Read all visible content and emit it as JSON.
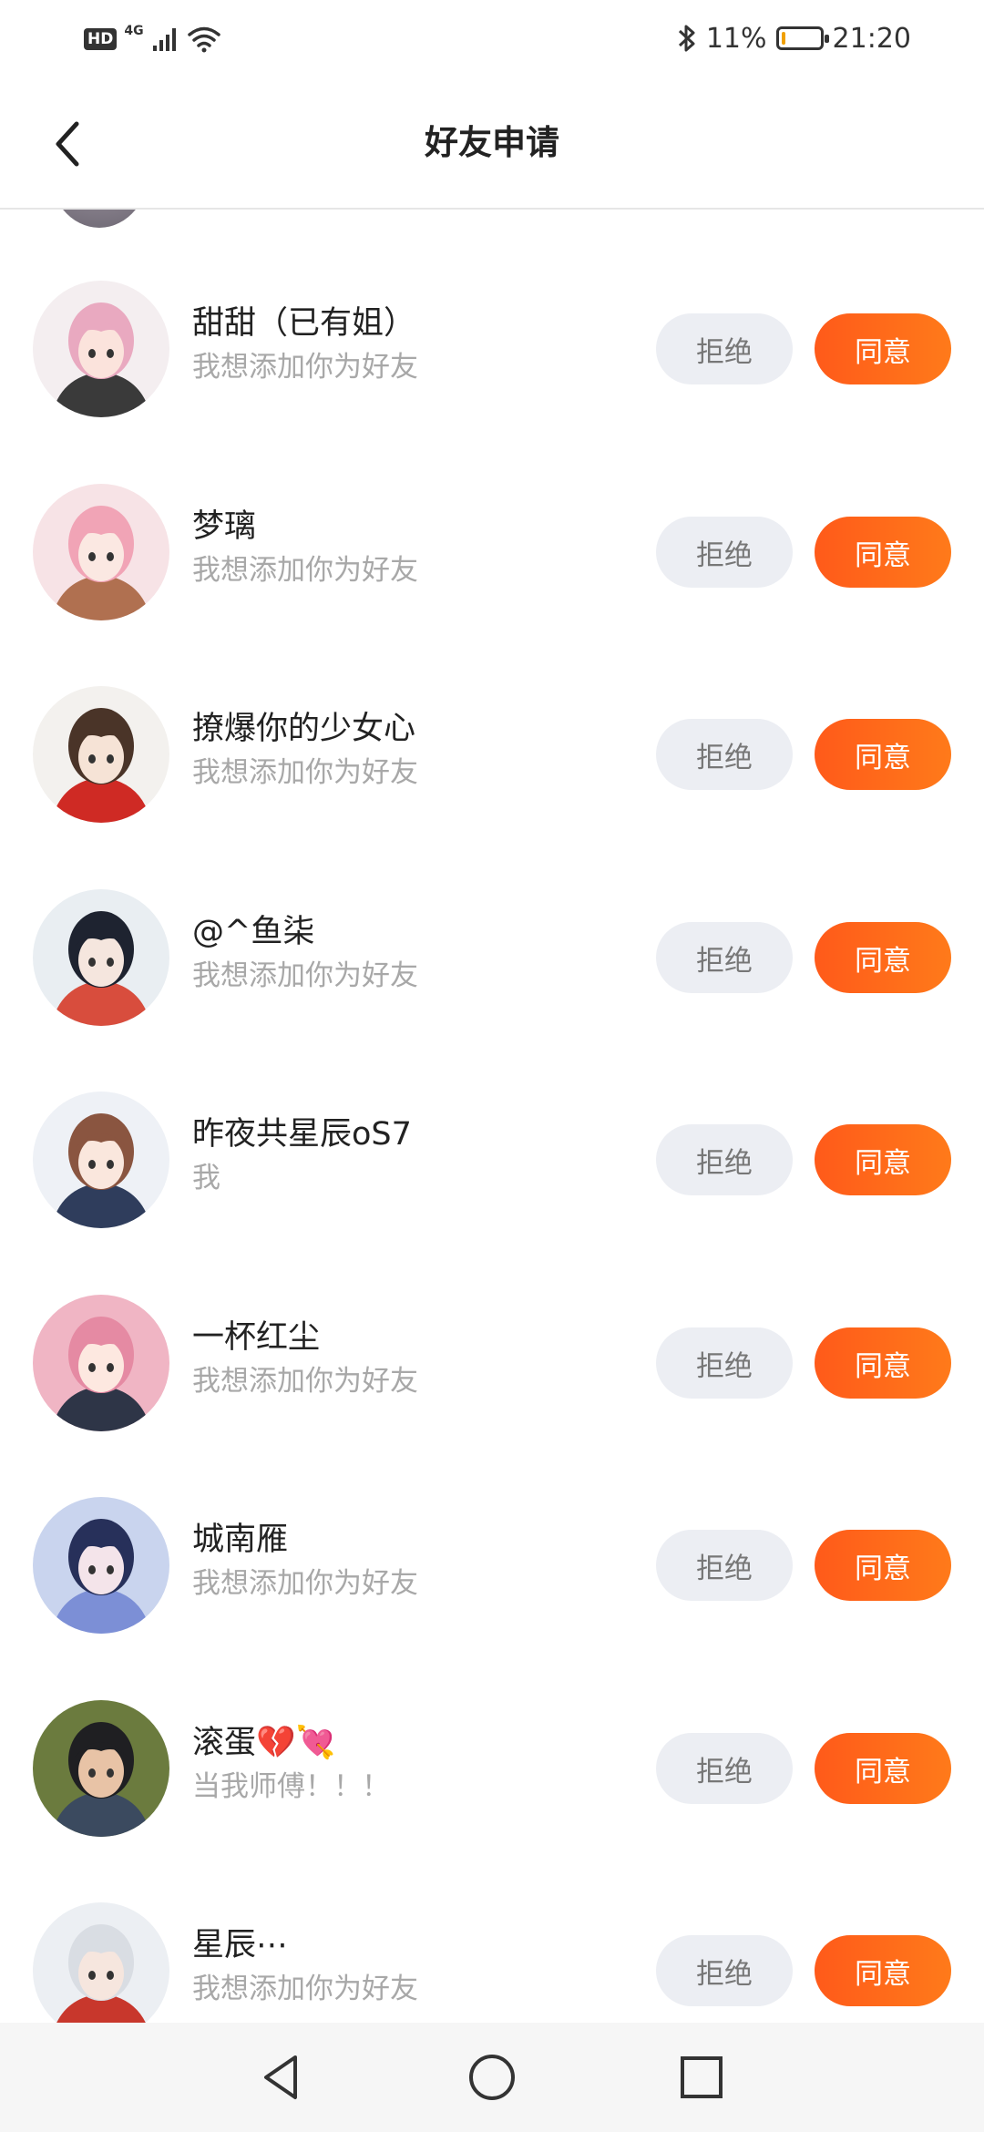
{
  "status_bar": {
    "hd": "HD",
    "network": "4G",
    "battery_percent": "11%",
    "battery_level": 0.11,
    "time": "21:20"
  },
  "header": {
    "title": "好友申请"
  },
  "buttons": {
    "reject": "拒绝",
    "accept": "同意"
  },
  "requests": [
    {
      "name": "甜甜（已有姐）",
      "message": "我想添加你为好友",
      "avatar": "anime-girl-pink-hair-weapon"
    },
    {
      "name": "梦璃",
      "message": "我想添加你为好友",
      "avatar": "anime-girl-pink-hat"
    },
    {
      "name": "撩爆你的少女心",
      "message": "我想添加你为好友",
      "avatar": "anime-boy-santa-hat"
    },
    {
      "name": "@^鱼柒",
      "message": "我想添加你为好友",
      "avatar": "anime-boy-dark-hair"
    },
    {
      "name": "昨夜共星辰oS7",
      "message": "我",
      "avatar": "anime-girl-headphones"
    },
    {
      "name": "一杯红尘",
      "message": "我想添加你为好友",
      "avatar": "anime-girl-pink-short-hair"
    },
    {
      "name": "城南雁",
      "message": "我想添加你为好友",
      "avatar": "anime-girl-dark-blue-hair"
    },
    {
      "name": "滚蛋💔💘",
      "message": "当我师傅！！！",
      "avatar": "photo-child-outdoor"
    },
    {
      "name": "星辰⋯",
      "message": "我想添加你为好友",
      "avatar": "anime-boy-red-white-hair"
    }
  ]
}
